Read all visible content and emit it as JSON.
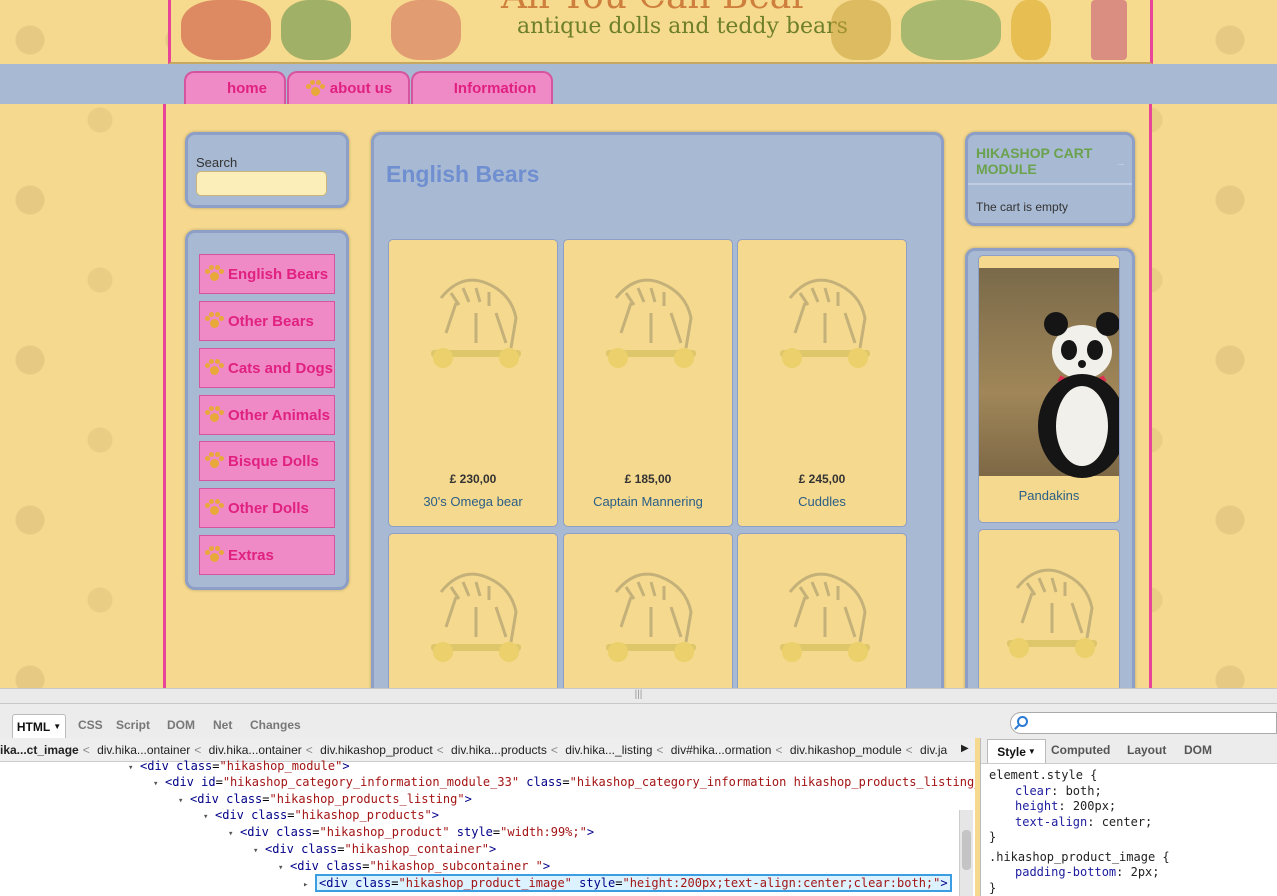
{
  "site": {
    "title": "All You Can Bear",
    "subtitle": "antique dolls and teddy bears"
  },
  "nav": [
    "home",
    "about us",
    "Information"
  ],
  "search": {
    "label": "Search",
    "value": ""
  },
  "categories": [
    "English Bears",
    "Other Bears",
    "Cats and Dogs",
    "Other Animals",
    "Bisque Dolls",
    "Other Dolls",
    "Extras"
  ],
  "main": {
    "title": "English Bears",
    "products": [
      {
        "price": "£ 230,00",
        "name": "30's Omega bear"
      },
      {
        "price": "£ 185,00",
        "name": "Captain Mannering"
      },
      {
        "price": "£ 245,00",
        "name": "Cuddles"
      },
      {
        "price": "",
        "name": ""
      },
      {
        "price": "",
        "name": ""
      },
      {
        "price": "",
        "name": ""
      }
    ]
  },
  "cart": {
    "title": "HIKASHOP CART MODULE",
    "toggle": "–",
    "empty": "The cart is empty"
  },
  "featured": [
    {
      "name": "Pandakins"
    },
    {
      "name": ""
    }
  ],
  "firebug": {
    "tabs": [
      "HTML",
      "CSS",
      "Script",
      "DOM",
      "Net",
      "Changes"
    ],
    "breadcrumb": [
      "ika...ct_image",
      "div.hika...ontainer",
      "div.hika...ontainer",
      "div.hikashop_product",
      "div.hika...products",
      "div.hika..._listing",
      "div#hika...ormation",
      "div.hikashop_module",
      "div.ja"
    ],
    "breadcrumb_next": "▶",
    "dom_lines": [
      {
        "expand": "▾",
        "tag_open": "<div",
        "attrs": [
          {
            "n": "class",
            "v": "\"hikashop_module\""
          }
        ],
        "tag_close": ">"
      },
      {
        "expand": "▾",
        "tag_open": "<div",
        "attrs": [
          {
            "n": "id",
            "v": "\"hikashop_category_information_module_33\""
          },
          {
            "n": "class",
            "v": "\"hikashop_category_information hikashop_products_listing_main\""
          }
        ],
        "tag_close": ">"
      },
      {
        "expand": "▾",
        "tag_open": "<div",
        "attrs": [
          {
            "n": "class",
            "v": "\"hikashop_products_listing\""
          }
        ],
        "tag_close": ">"
      },
      {
        "expand": "▾",
        "tag_open": "<div",
        "attrs": [
          {
            "n": "class",
            "v": "\"hikashop_products\""
          }
        ],
        "tag_close": ">"
      },
      {
        "expand": "▾",
        "tag_open": "<div",
        "attrs": [
          {
            "n": "class",
            "v": "\"hikashop_product\""
          },
          {
            "n": "style",
            "v": "\"width:99%;\""
          }
        ],
        "tag_close": ">"
      },
      {
        "expand": "▾",
        "tag_open": "<div",
        "attrs": [
          {
            "n": "class",
            "v": "\"hikashop_container\""
          }
        ],
        "tag_close": ">"
      },
      {
        "expand": "▾",
        "tag_open": "<div",
        "attrs": [
          {
            "n": "class",
            "v": "\"hikashop_subcontainer \""
          }
        ],
        "tag_close": ">"
      },
      {
        "expand": "▸",
        "tag_open": "<div",
        "attrs": [
          {
            "n": "class",
            "v": "\"hikashop_product_image\""
          },
          {
            "n": "style",
            "v": "\"height:200px;text-align:center;clear:both;\""
          }
        ],
        "tag_close": ">"
      }
    ],
    "right_tabs": [
      "Style",
      "Computed",
      "Layout",
      "DOM"
    ],
    "css": {
      "rule1_selector": "element.style {",
      "rule1_props": [
        {
          "p": "clear",
          "v": "both;"
        },
        {
          "p": "height",
          "v": "200px;"
        },
        {
          "p": "text-align",
          "v": "center;"
        }
      ],
      "rule1_end": "}",
      "rule2_selector": ".hikashop_product_image {",
      "rule2_props": [
        {
          "p": "padding-bottom",
          "v": "2px;"
        }
      ],
      "rule2_end": "}"
    }
  },
  "colors": {
    "pink": "#ef8ac6",
    "pink_text": "#e0217f",
    "panel_blue": "#a8b9d3",
    "yellow": "#f5d98e",
    "link": "#2b5f86",
    "cart_green": "#6aa24e"
  }
}
